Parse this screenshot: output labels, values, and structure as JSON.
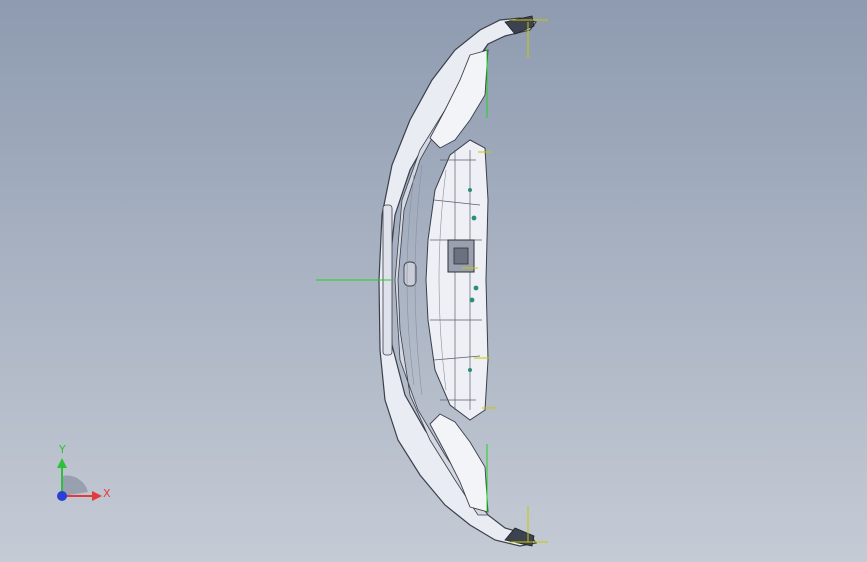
{
  "viewport": {
    "background_top": "#8e9bb0",
    "background_bottom": "#c5cbd5"
  },
  "model": {
    "part_fill": "#e9ecf3",
    "edge_color": "#3a3f4a",
    "shade_color": "#8a90a0"
  },
  "reference_axes": {
    "x_color": "#1fd61f",
    "y_color": "#c8c800"
  },
  "triad": {
    "x_label": "X",
    "y_label": "Y",
    "x_color": "#e23b3b",
    "y_color": "#2fbf3a",
    "z_color": "#2b3fd6",
    "icon": "coordinate-triad-icon"
  }
}
